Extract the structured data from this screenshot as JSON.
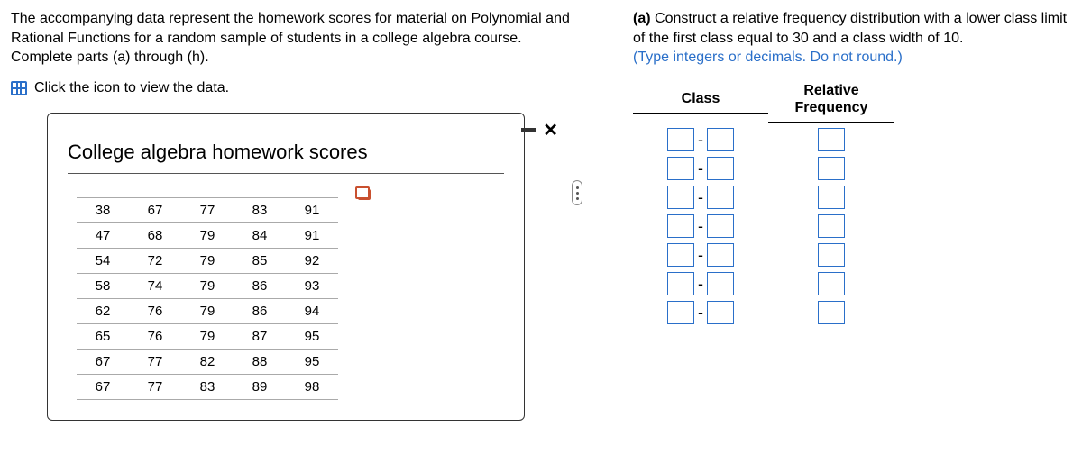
{
  "intro": "The accompanying data represent the homework scores for material on Polynomial and Rational Functions for a random sample of students in a college algebra course. Complete parts (a) through (h).",
  "link_text": "Click the icon to view the data.",
  "panel": {
    "title": "College algebra homework scores",
    "rows": [
      [
        "38",
        "67",
        "77",
        "83",
        "91"
      ],
      [
        "47",
        "68",
        "79",
        "84",
        "91"
      ],
      [
        "54",
        "72",
        "79",
        "85",
        "92"
      ],
      [
        "58",
        "74",
        "79",
        "86",
        "93"
      ],
      [
        "62",
        "76",
        "79",
        "86",
        "94"
      ],
      [
        "65",
        "76",
        "79",
        "87",
        "95"
      ],
      [
        "67",
        "77",
        "82",
        "88",
        "95"
      ],
      [
        "67",
        "77",
        "83",
        "89",
        "98"
      ]
    ]
  },
  "part_a": {
    "label": "(a)",
    "text": "Construct a relative frequency distribution with a lower class limit of the first class equal to 30 and a class width of 10.",
    "hint": "(Type integers or decimals. Do not round.)"
  },
  "headers": {
    "class": "Class",
    "rel": "Relative Frequency"
  },
  "dash": "-",
  "row_count": 7
}
